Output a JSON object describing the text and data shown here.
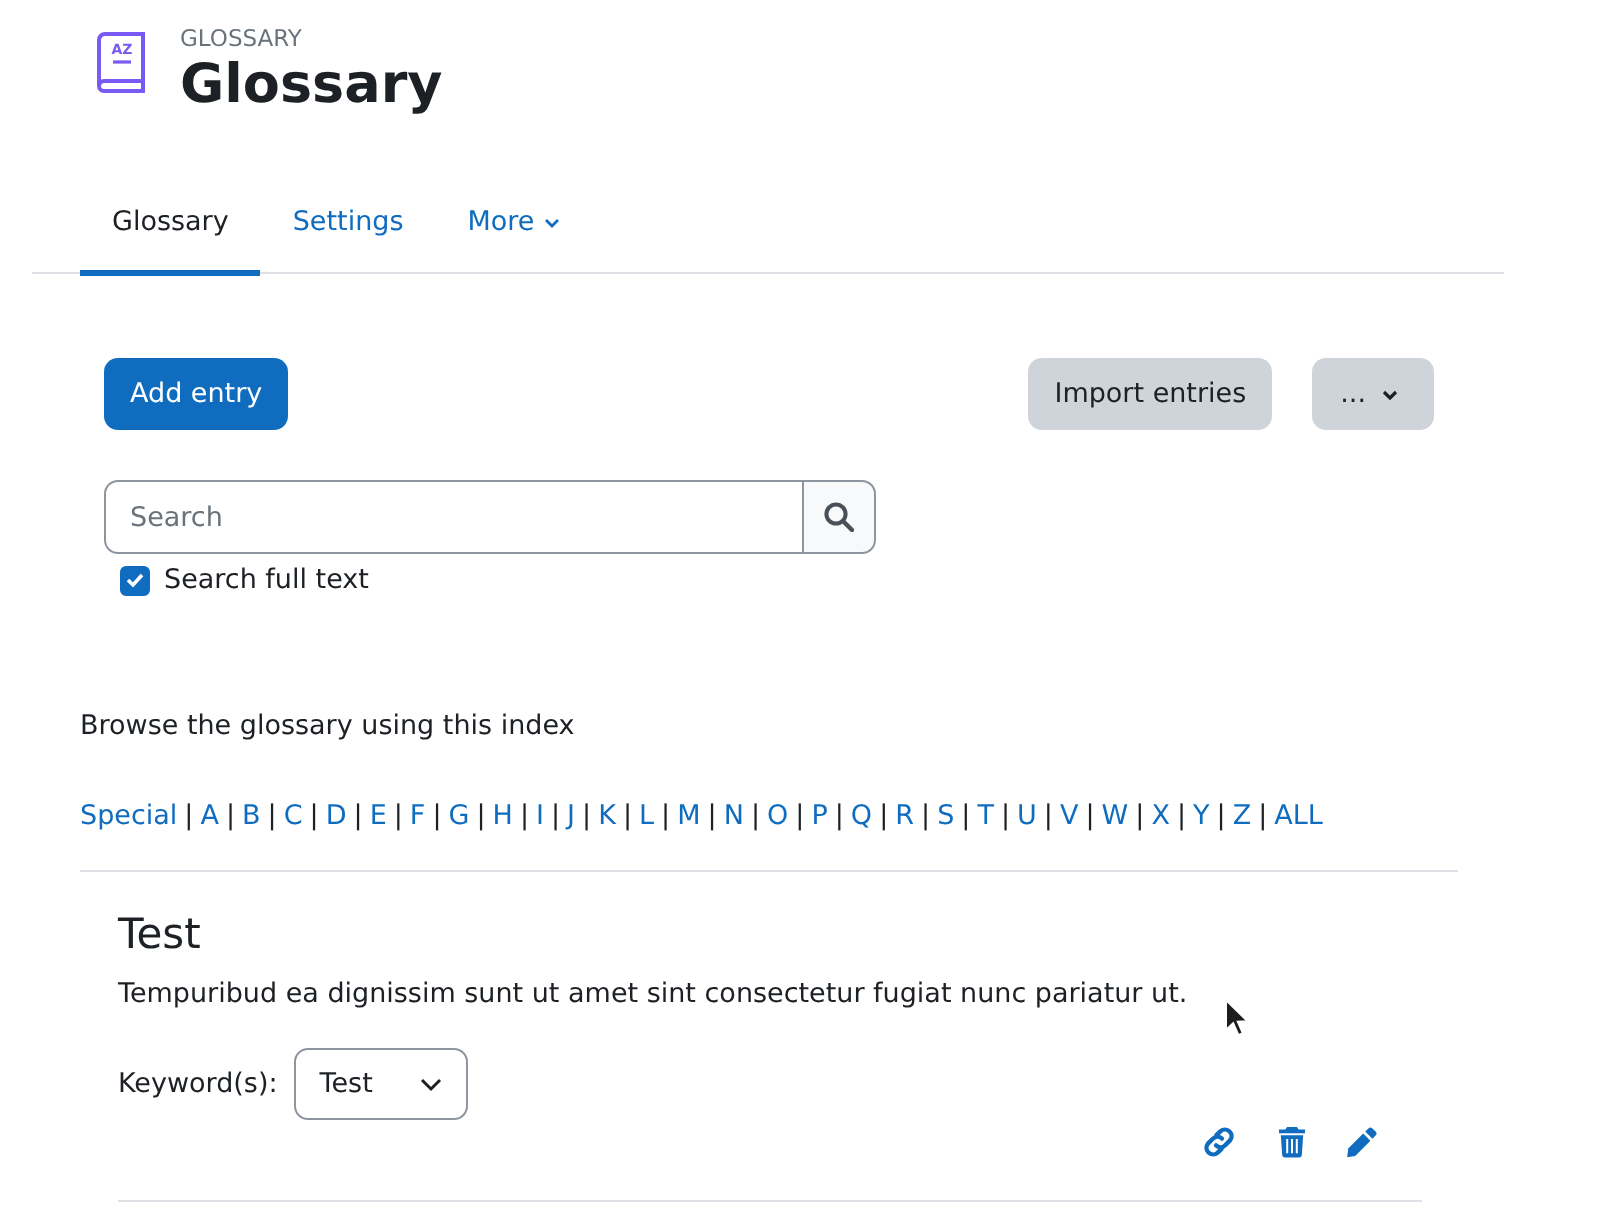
{
  "header": {
    "icon_text": "AZ",
    "context": "GLOSSARY",
    "title": "Glossary"
  },
  "tabs": [
    {
      "label": "Glossary",
      "selected": true,
      "kind": "link"
    },
    {
      "label": "Settings",
      "selected": false,
      "kind": "link"
    },
    {
      "label": "More",
      "selected": false,
      "kind": "dropdown"
    }
  ],
  "actions": {
    "primary": "Add entry",
    "secondary": "Import entries",
    "menu": "..."
  },
  "search": {
    "placeholder": "Search",
    "full_text": {
      "label": "Search full text",
      "checked": true
    }
  },
  "index": {
    "intro": "Browse the glossary using this index",
    "separator": "|",
    "letters": [
      "Special",
      "A",
      "B",
      "C",
      "D",
      "E",
      "F",
      "G",
      "H",
      "I",
      "J",
      "K",
      "L",
      "M",
      "N",
      "O",
      "P",
      "Q",
      "R",
      "S",
      "T",
      "U",
      "V",
      "W",
      "X",
      "Y",
      "Z",
      "ALL"
    ]
  },
  "entries": [
    {
      "term": "Test",
      "definition": "Tempuribud ea dignissim sunt ut amet sint consectetur fugiat nunc pariatur ut.",
      "keywords_label": "Keyword(s):",
      "keyword": "Test"
    }
  ]
}
